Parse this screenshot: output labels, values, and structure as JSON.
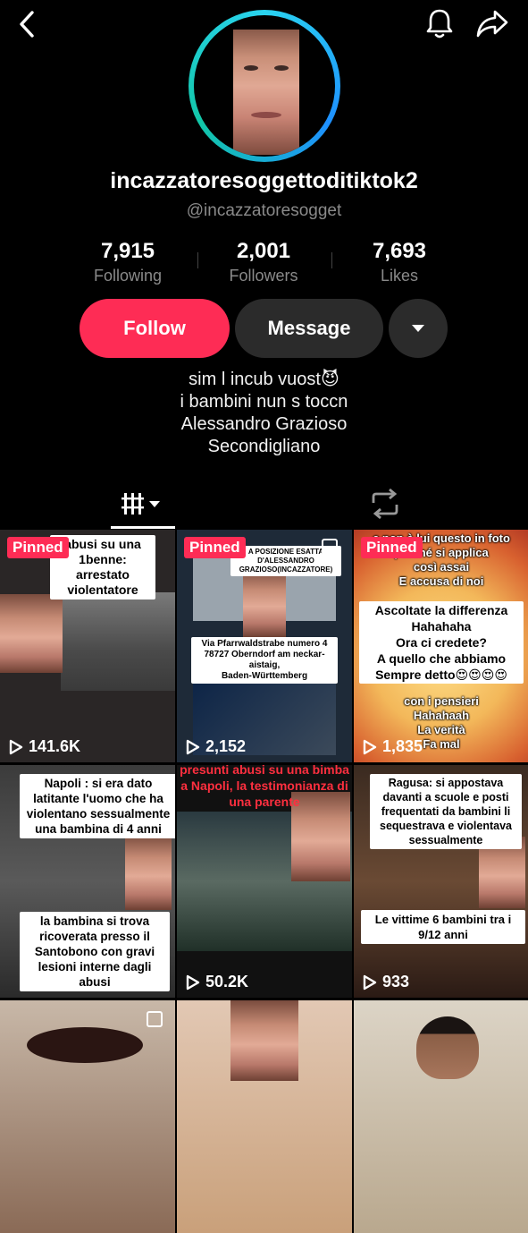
{
  "header": {
    "back_icon": "chevron-left-icon",
    "bell_icon": "bell-icon",
    "share_icon": "share-arrow-icon"
  },
  "profile": {
    "display_name": "incazzatoresoggettoditiktok2",
    "handle": "@incazzatoresogget",
    "ring_colors": [
      "#2ad4f0",
      "#1e90ff",
      "#12c7a8"
    ]
  },
  "stats": [
    {
      "value": "7,915",
      "label": "Following"
    },
    {
      "value": "2,001",
      "label": "Followers"
    },
    {
      "value": "7,693",
      "label": "Likes"
    }
  ],
  "actions": {
    "follow_label": "Follow",
    "message_label": "Message",
    "follow_color": "#fe2c55"
  },
  "bio": [
    "sim l incub vuost😈",
    "i bambini nun s toccn",
    "Alessandro Grazioso",
    "Secondigliano"
  ],
  "tabs": {
    "videos_icon": "grid-icon",
    "reposts_icon": "repost-icon"
  },
  "videos": [
    {
      "pinned": "Pinned",
      "plays": "141.6K",
      "caption": [
        "abusi su una",
        "1benne: arrestato",
        "violentatore"
      ]
    },
    {
      "pinned": "Pinned",
      "plays": "2,152",
      "caption": [
        "A POSIZIONE ESATTA",
        "D'ALESSANDRO GRAZIOSO(INCAZZATORE)"
      ],
      "sub": [
        "Via Pfarrwaldstrabe numero 4",
        "78727 Oberndorf am neckar-aistaig,",
        "Baden-Württemberg"
      ]
    },
    {
      "pinned": "Pinned",
      "plays": "1,835",
      "top_lines": [
        "e non è lui questo in foto",
        "perché si applica",
        "così assai",
        "E accusa di noi"
      ],
      "caption": [
        "Ascoltate la differenza",
        "Hahahaha",
        "Ora ci credete?",
        "A quello che abbiamo",
        "Sempre detto😍😍😍😍"
      ],
      "bottom_lines": [
        "con i pensieri",
        "Hahahaah",
        "La verità",
        "Fa mal"
      ]
    },
    {
      "plays": "",
      "caption": [
        "Napoli : si era dato",
        "latitante l'uomo che ha",
        "violentano sessualmente",
        "una bambina di 4 anni"
      ],
      "bottom_caption": [
        "la bambina si trova",
        "ricoverata presso il",
        "Santobono con gravi",
        "lesioni interne dagli abusi"
      ]
    },
    {
      "plays": "50.2K",
      "red_caption": [
        "presunti abusi su una bimba",
        "a Napoli, la testimonianza di",
        "una parente"
      ]
    },
    {
      "plays": "933",
      "caption": [
        "Ragusa: si appostava",
        "davanti a scuole e posti",
        "frequentati da bambini li",
        "sequestrava e violentava",
        "sessualmente"
      ],
      "bottom_caption": [
        "Le vittime 6 bambini tra i",
        "9/12 anni"
      ]
    }
  ]
}
